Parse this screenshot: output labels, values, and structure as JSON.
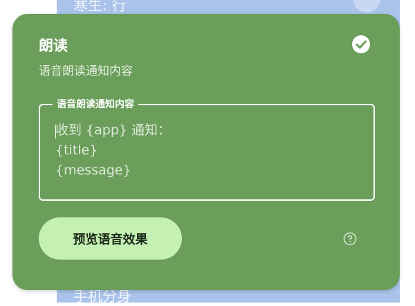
{
  "background": {
    "top_text": "寒生: 行",
    "bottom_text": "手机分身"
  },
  "dialog": {
    "title": "朗读",
    "subtitle": "语音朗读通知内容",
    "field": {
      "label": "语音朗读通知内容",
      "value": "收到 {app} 通知：\n{title}\n{message}"
    },
    "preview_button": "预览语音效果"
  },
  "colors": {
    "card": "#6a9e5a",
    "button": "#c4f0b4",
    "background": "#a9c3ea"
  },
  "icons": {
    "confirm": "check-circle-icon",
    "help": "help-circle-icon"
  }
}
